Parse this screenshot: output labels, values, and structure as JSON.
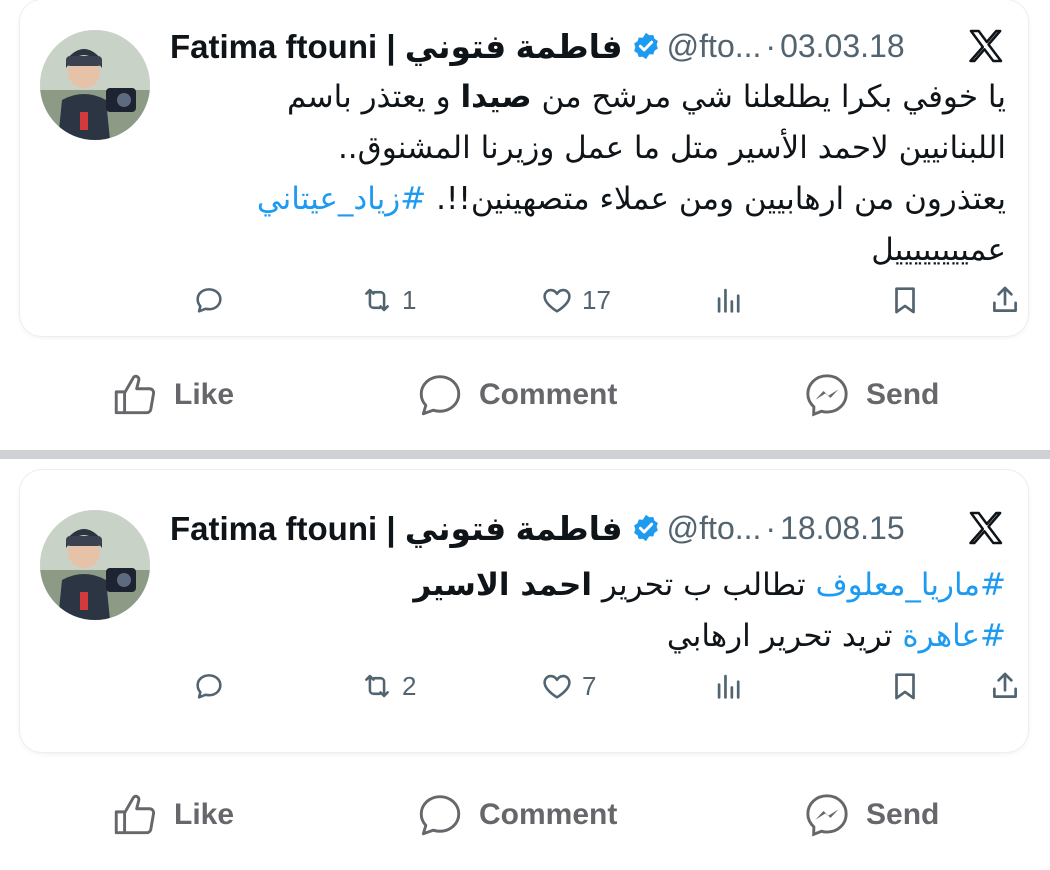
{
  "tweets": [
    {
      "author_name": "Fatima ftouni | فاطمة فتوني",
      "handle": "@fto...",
      "dot": "·",
      "date": "03.03.18",
      "lines": [
        {
          "parts": [
            {
              "t": "يا خوفي بكرا يطلعلنا شي مرشح من "
            },
            {
              "t": "صيدا",
              "b": true
            },
            {
              "t": " و يعتذر باسم"
            }
          ]
        },
        {
          "parts": [
            {
              "t": "اللبنانيين لاحمد الأسير متل ما عمل وزيرنا المشنوق.."
            }
          ]
        },
        {
          "parts": [
            {
              "t": "يعتذرون من ارهابيين ومن عملاء متصهينين!!. "
            },
            {
              "t": "#زياد_عيتاني",
              "h": true
            }
          ]
        },
        {
          "parts": [
            {
              "t": "عمييييييييل"
            }
          ]
        }
      ],
      "reply_count": "",
      "retweet_count": "1",
      "like_count": "17"
    },
    {
      "author_name": "Fatima ftouni | فاطمة فتوني",
      "handle": "@fto...",
      "dot": "·",
      "date": "18.08.15",
      "lines": [
        {
          "parts": [
            {
              "t": "#ماريا_معلوف",
              "h": true
            },
            {
              "t": " تطالب ب تحرير "
            },
            {
              "t": "احمد الاسير",
              "b": true
            }
          ]
        },
        {
          "parts": [
            {
              "t": "#عاهرة",
              "h": true
            },
            {
              "t": " تريد تحرير ارهابي"
            }
          ]
        }
      ],
      "reply_count": "",
      "retweet_count": "2",
      "like_count": "7"
    }
  ],
  "facebook_bar": {
    "like_label": "Like",
    "comment_label": "Comment",
    "send_label": "Send"
  },
  "colors": {
    "hashtag": "#1d9bf0",
    "verified": "#1d9bf0",
    "secondary_text": "#536471",
    "fb_text": "#65676b",
    "divider": "#cfd1d4"
  },
  "icons": [
    "avatar-photo",
    "verified-badge-icon",
    "x-logo-icon",
    "reply-icon",
    "retweet-icon",
    "like-heart-icon",
    "views-icon",
    "bookmark-icon",
    "share-icon",
    "fb-like-icon",
    "fb-comment-icon",
    "fb-send-icon"
  ]
}
